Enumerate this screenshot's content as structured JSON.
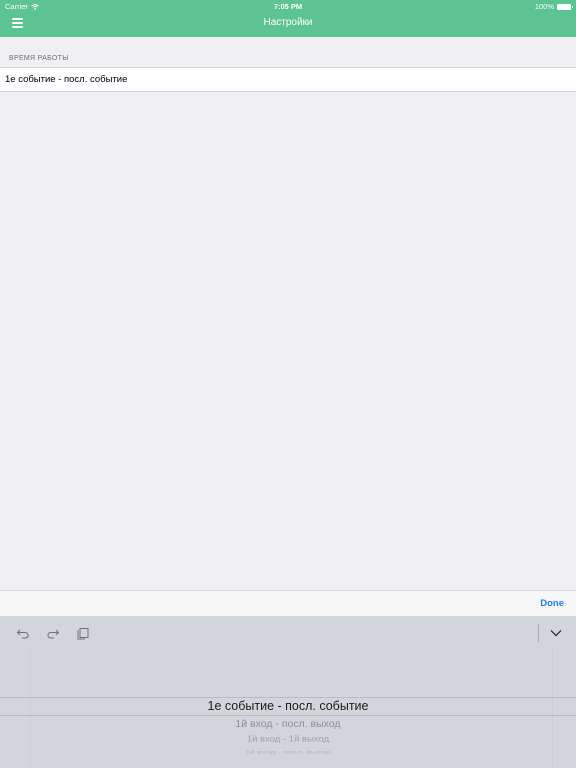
{
  "status_bar": {
    "carrier": "Carrier",
    "time": "7:05 PM",
    "battery": "100%"
  },
  "nav": {
    "title": "Настройки",
    "menu_icon": "hamburger-menu-icon"
  },
  "section": {
    "header": "ВРЕМЯ РАБОТЫ",
    "cell_value": "1е событие - посл. событие"
  },
  "accessory": {
    "done_label": "Done"
  },
  "keyboard_toolbar": {
    "icons": [
      "undo-icon",
      "redo-icon",
      "paste-icon",
      "dismiss-keyboard-icon"
    ]
  },
  "picker": {
    "selected": "1е событие - посл. событие",
    "options_below": [
      "1й вход - посл. выход",
      "1й вход - 1й выход",
      "1й вход - посл. выход"
    ]
  },
  "colors": {
    "header": "#5cc393",
    "accent": "#1a7de8",
    "background": "#efeff4"
  }
}
